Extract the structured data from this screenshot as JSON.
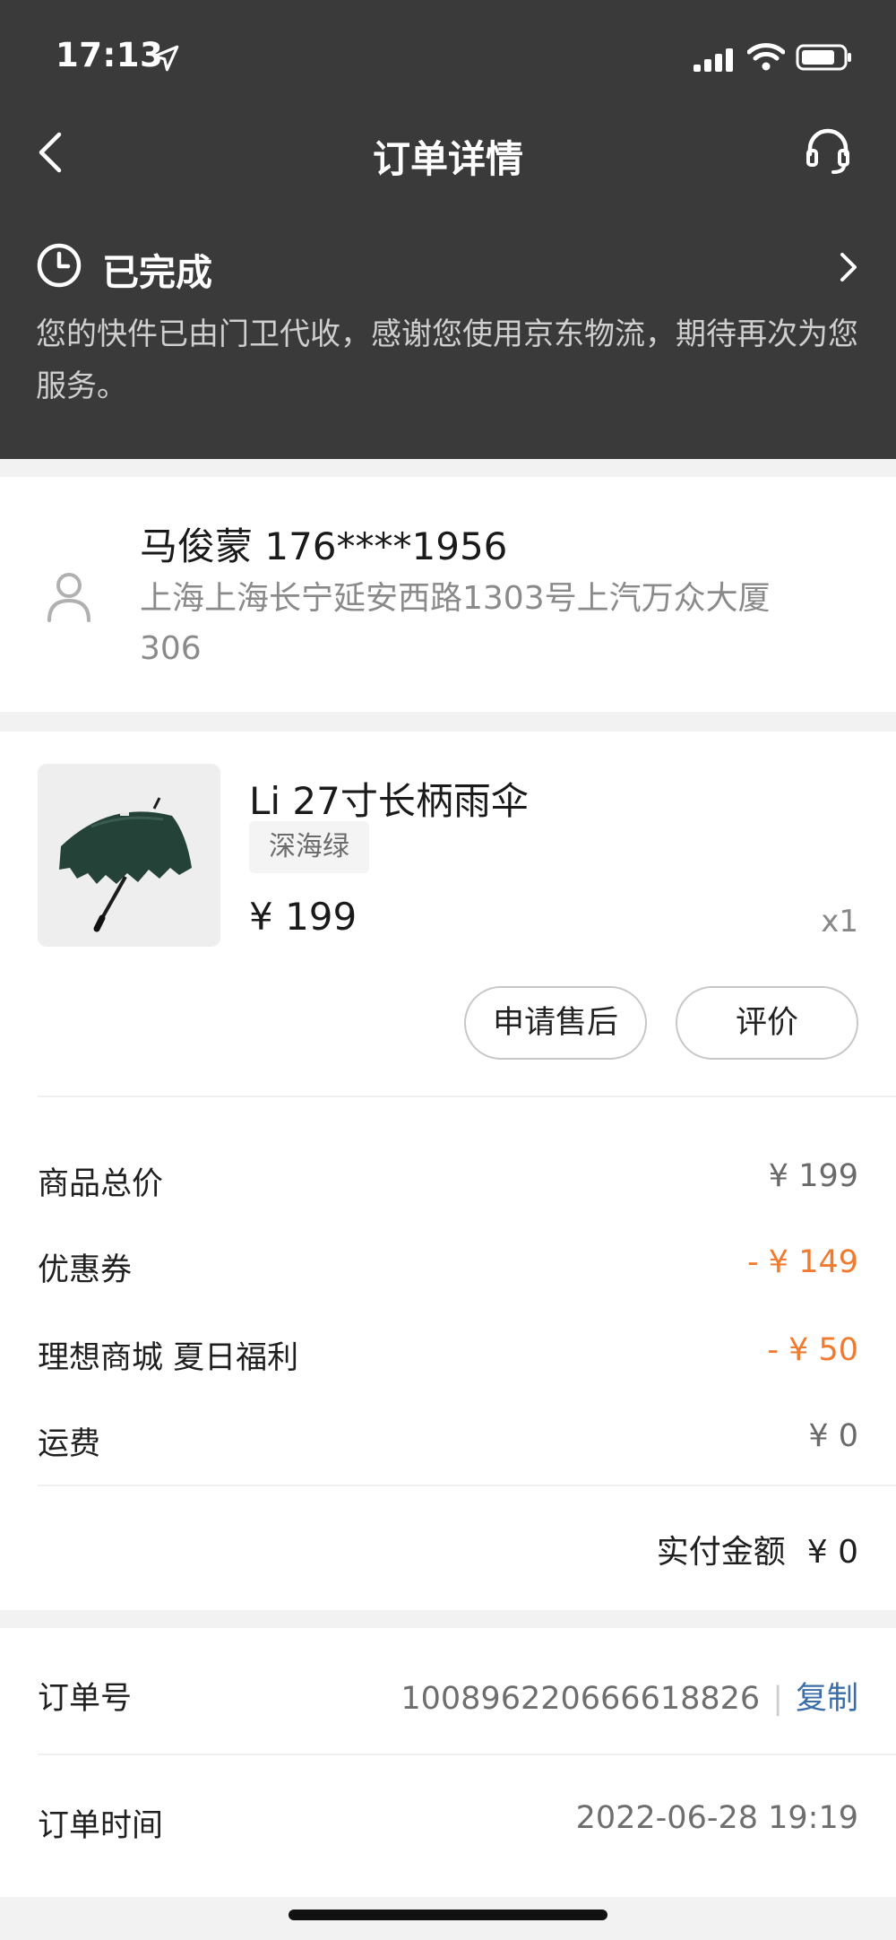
{
  "status_bar": {
    "time": "17:13"
  },
  "nav": {
    "title": "订单详情"
  },
  "order_status": {
    "title": "已完成",
    "description": "您的快件已由门卫代收，感谢您使用京东物流，期待再次为您服务。"
  },
  "address": {
    "name_phone": "马俊蒙 176****1956",
    "address": "上海上海长宁延安西路1303号上汽万众大厦306"
  },
  "product": {
    "name": "Li 27寸长柄雨伞",
    "variant": "深海绿",
    "price": "¥ 199",
    "quantity": "x1",
    "after_sale_label": "申请售后",
    "review_label": "评价"
  },
  "summary": {
    "rows": [
      {
        "label": "商品总价",
        "value": "¥ 199",
        "color": "#6a6a6a"
      },
      {
        "label": "优惠券",
        "value": "- ¥ 149",
        "color": "#f07a2e"
      },
      {
        "label": "理想商城 夏日福利",
        "value": "- ¥ 50",
        "color": "#f07a2e"
      },
      {
        "label": "运费",
        "value": "¥ 0",
        "color": "#6a6a6a"
      }
    ],
    "paid_label": "实付金额",
    "paid_value": "¥ 0"
  },
  "order_info": {
    "number_label": "订单号",
    "number": "100896220666618826",
    "copy_label": "复制",
    "time_label": "订单时间",
    "time": "2022-06-28 19:19"
  }
}
